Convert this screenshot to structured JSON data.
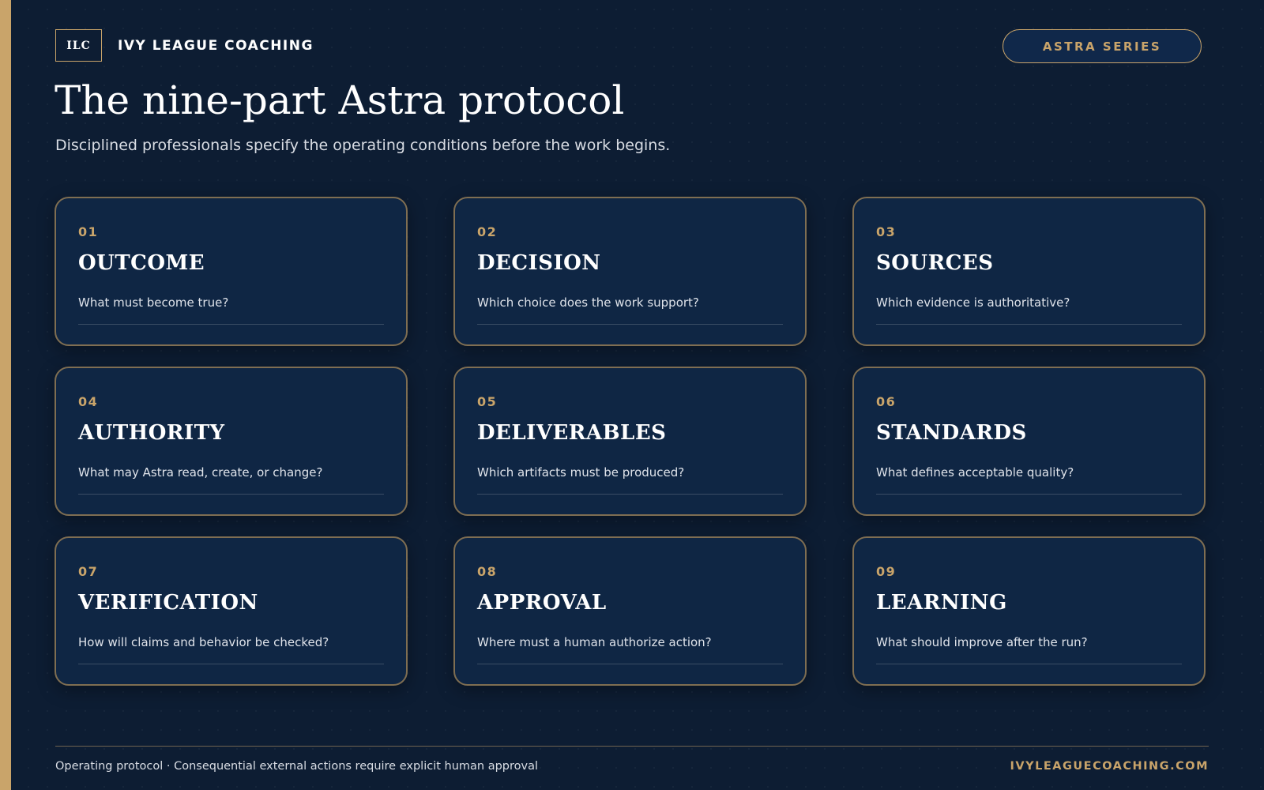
{
  "brand": {
    "logo_text": "ILC",
    "name": "IVY LEAGUE COACHING"
  },
  "series_badge": "ASTRA SERIES",
  "page_title": "The nine-part Astra protocol",
  "subtitle": "Disciplined professionals specify the operating conditions before the work begins.",
  "cards": [
    {
      "number": "01",
      "title": "OUTCOME",
      "question": "What must become true?"
    },
    {
      "number": "02",
      "title": "DECISION",
      "question": "Which choice does the work support?"
    },
    {
      "number": "03",
      "title": "SOURCES",
      "question": "Which evidence is authoritative?"
    },
    {
      "number": "04",
      "title": "AUTHORITY",
      "question": "What may Astra read, create, or change?"
    },
    {
      "number": "05",
      "title": "DELIVERABLES",
      "question": "Which artifacts must be produced?"
    },
    {
      "number": "06",
      "title": "STANDARDS",
      "question": "What defines acceptable quality?"
    },
    {
      "number": "07",
      "title": "VERIFICATION",
      "question": "How will claims and behavior be checked?"
    },
    {
      "number": "08",
      "title": "APPROVAL",
      "question": "Where must a human authorize action?"
    },
    {
      "number": "09",
      "title": "LEARNING",
      "question": "What should improve after the run?"
    }
  ],
  "footer": {
    "note": "Operating protocol · Consequential external actions require explicit human approval",
    "url": "IVYLEAGUECOACHING.COM"
  },
  "colors": {
    "background": "#0d1d33",
    "card_background": "#0f2644",
    "accent_gold": "#c9a46a",
    "text_primary": "#ffffff"
  }
}
